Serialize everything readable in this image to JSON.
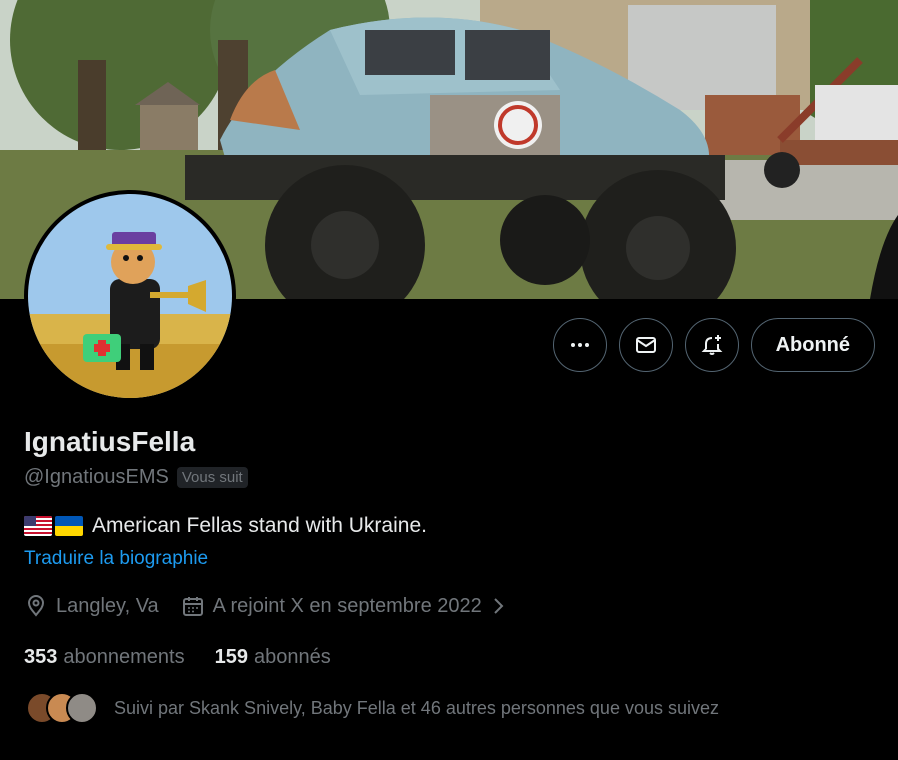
{
  "profile": {
    "display_name": "IgnatiusFella",
    "handle": "@IgnatiousEMS",
    "follows_you_badge": "Vous suit",
    "bio_text": "American Fellas stand with Ukraine.",
    "bio_flags": [
      "us-flag-icon",
      "ukraine-flag-icon"
    ],
    "translate_bio": "Traduire la biographie",
    "location": "Langley, Va",
    "joined": "A rejoint X en septembre 2022"
  },
  "stats": {
    "following_count": "353",
    "following_label": "abonnements",
    "followers_count": "159",
    "followers_label": "abonnés"
  },
  "followed_by": {
    "text": "Suivi par Skank Snively, Baby Fella et 46 autres personnes que vous suivez"
  },
  "actions": {
    "more_icon": "more-icon",
    "message_icon": "mail-icon",
    "notify_icon": "bell-plus-icon",
    "follow_label": "Abonné"
  },
  "colors": {
    "background": "#000000",
    "primary_text": "#e7e9ea",
    "secondary_text": "#71767b",
    "link": "#1d9bf0",
    "border": "#536471"
  }
}
